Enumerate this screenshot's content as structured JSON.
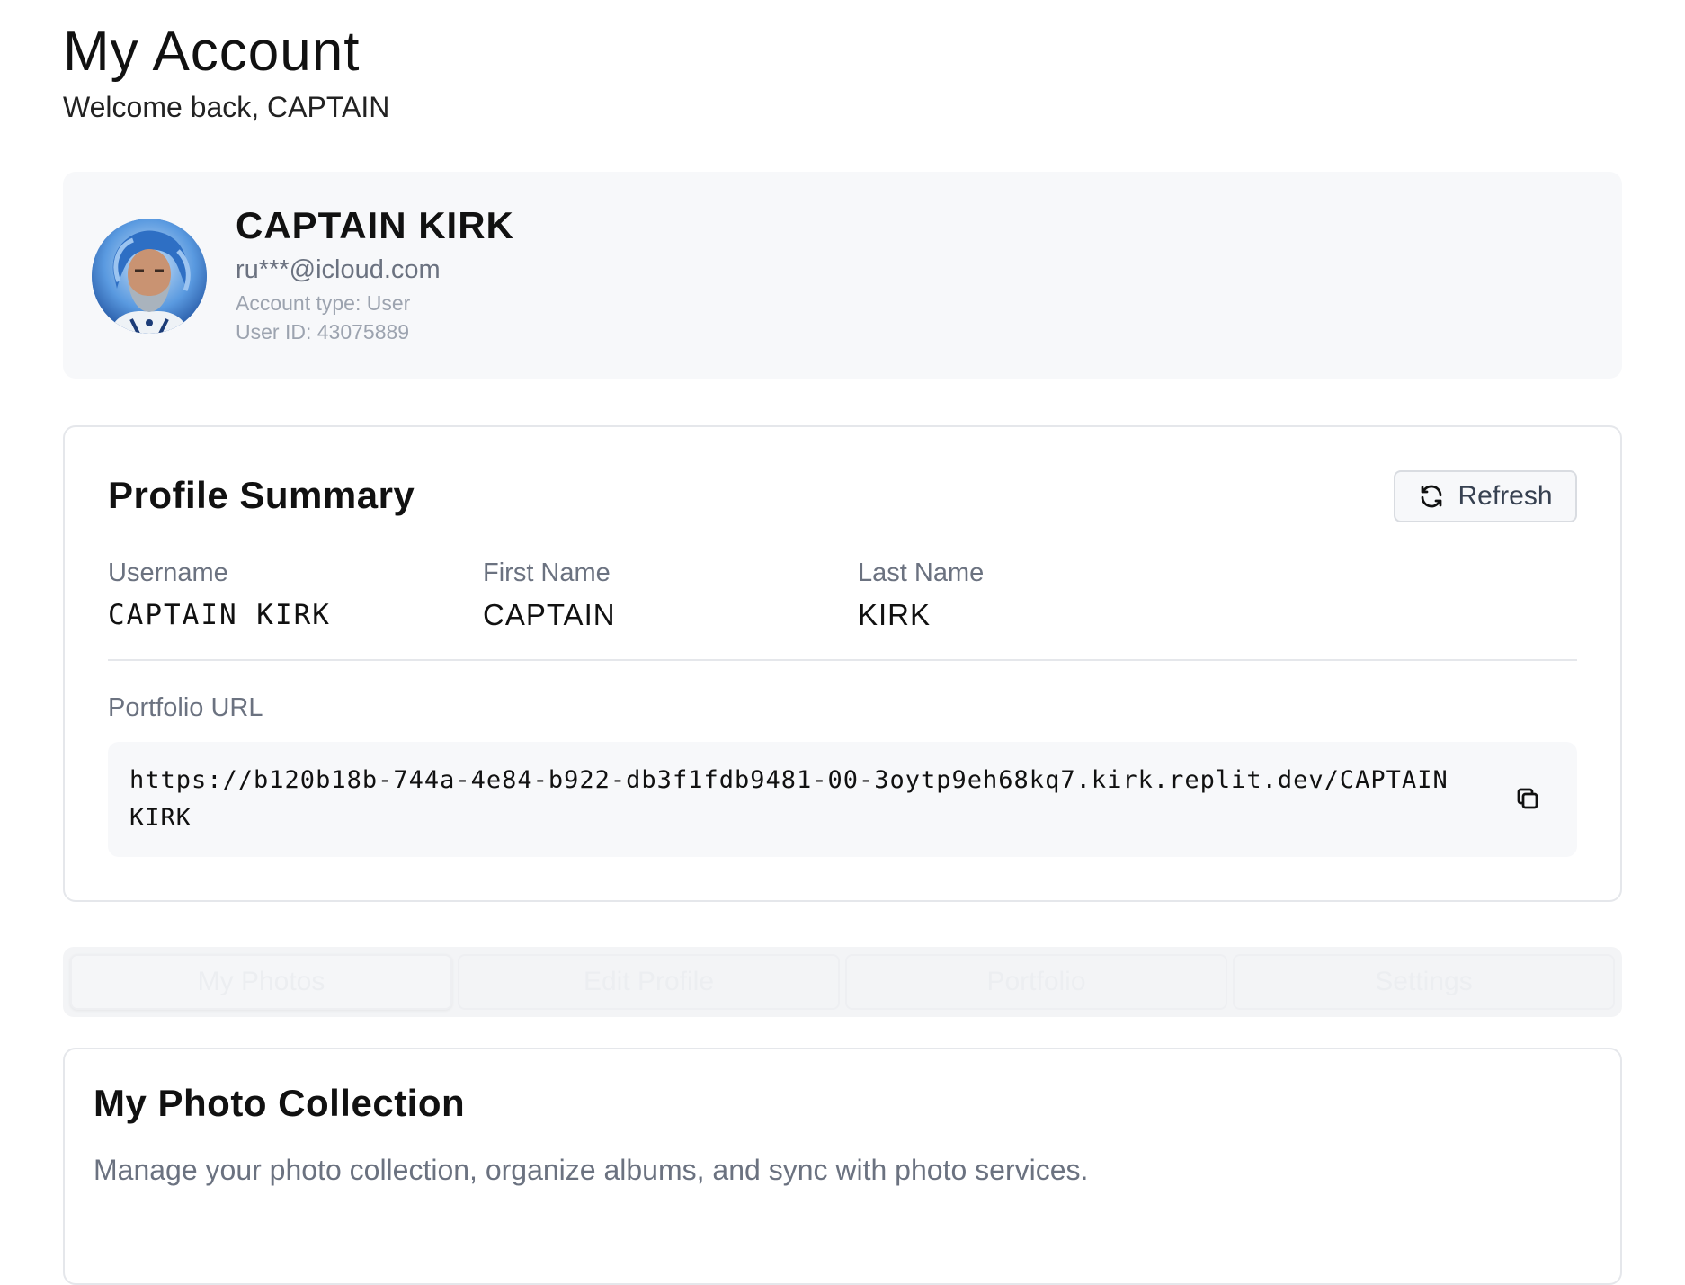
{
  "header": {
    "title": "My Account",
    "subtitle": "Welcome back, CAPTAIN"
  },
  "profile": {
    "name": "CAPTAIN KIRK",
    "email": "ru***@icloud.com",
    "account_type": "Account type: User",
    "user_id": "User ID: 43075889"
  },
  "summary": {
    "title": "Profile Summary",
    "refresh_label": "Refresh",
    "fields": [
      {
        "label": "Username",
        "value": "CAPTAIN KIRK"
      },
      {
        "label": "First Name",
        "value": "CAPTAIN"
      },
      {
        "label": "Last Name",
        "value": "KIRK"
      }
    ],
    "portfolio_label": "Portfolio URL",
    "portfolio_url": "https://b120b18b-744a-4e84-b922-db3f1fdb9481-00-3oytp9eh68kq7.kirk.replit.dev/CAPTAIN KIRK"
  },
  "tabs": [
    {
      "label": "My Photos",
      "active": true
    },
    {
      "label": "Edit Profile",
      "active": false
    },
    {
      "label": "Portfolio",
      "active": false
    },
    {
      "label": "Settings",
      "active": false
    }
  ],
  "collection": {
    "title": "My Photo Collection",
    "description": "Manage your photo collection, organize albums, and sync with photo services."
  },
  "icons": {
    "refresh": "refresh-icon",
    "copy": "copy-icon"
  }
}
